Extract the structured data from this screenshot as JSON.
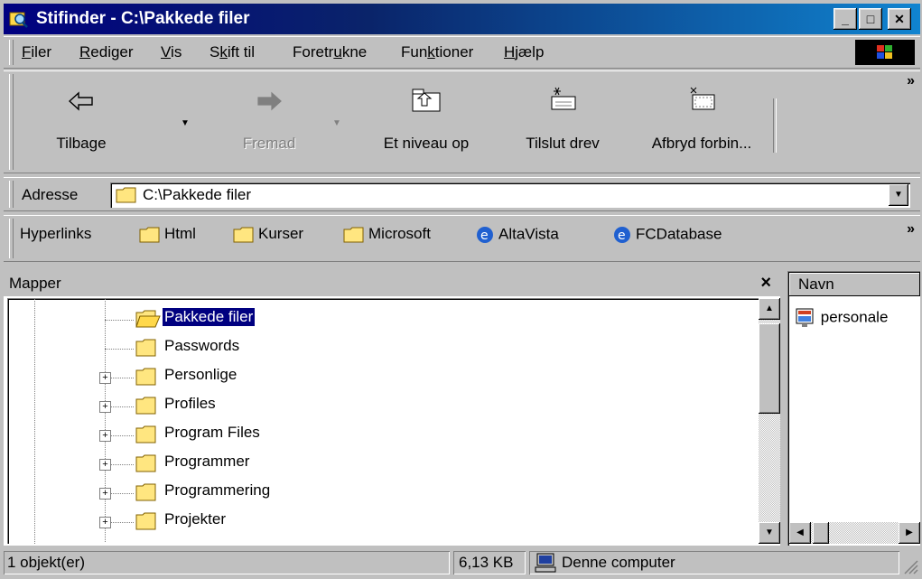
{
  "window": {
    "title": "Stifinder - C:\\Pakkede filer"
  },
  "menu": [
    {
      "pre": "",
      "key": "F",
      "post": "iler"
    },
    {
      "pre": "",
      "key": "R",
      "post": "ediger"
    },
    {
      "pre": "",
      "key": "V",
      "post": "is"
    },
    {
      "pre": "S",
      "key": "k",
      "post": "ift til"
    },
    {
      "pre": "Foretr",
      "key": "u",
      "post": "kne"
    },
    {
      "pre": "Fun",
      "key": "k",
      "post": "tioner"
    },
    {
      "pre": "",
      "key": "H",
      "post": "jælp"
    }
  ],
  "toolbar": {
    "back": "Tilbage",
    "forward": "Fremad",
    "up": "Et niveau op",
    "map": "Tilslut drev",
    "disconnect": "Afbryd forbin..."
  },
  "address": {
    "label": "Adresse",
    "value": "C:\\Pakkede filer"
  },
  "links": {
    "label": "Hyperlinks",
    "items": [
      "Html",
      "Kurser",
      "Microsoft",
      "AltaVista",
      "FCDatabase"
    ]
  },
  "folders": {
    "header": "Mapper",
    "items": [
      "Pakkede filer",
      "Passwords",
      "Personlige",
      "Profiles",
      "Program Files",
      "Programmer",
      "Programmering",
      "Projekter"
    ]
  },
  "files": {
    "column": "Navn",
    "items": [
      "personale"
    ]
  },
  "status": {
    "count": "1 objekt(er)",
    "size": "6,13 KB",
    "location": "Denne computer"
  },
  "colors": {
    "title_bar": "#000080",
    "selection": "#000080",
    "face": "#c0c0c0"
  }
}
